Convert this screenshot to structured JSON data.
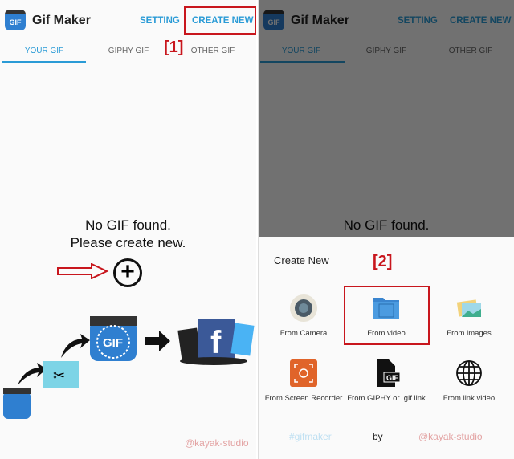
{
  "app": {
    "title": "Gif Maker",
    "logo_text": "GIF",
    "setting": "SETTING",
    "create_new": "CREATE NEW"
  },
  "tabs": [
    {
      "label": "YOUR GIF",
      "selected": true
    },
    {
      "label": "GIPHY GIF"
    },
    {
      "label": "OTHER GIF"
    }
  ],
  "annotations": {
    "step1": "[1]",
    "step2": "[2]",
    "color": "#c8161d"
  },
  "empty": {
    "line1": "No GIF found.",
    "line2": "Please create new."
  },
  "illustration": {
    "gif_text": "GIF",
    "facebook": "f"
  },
  "watermark": "@kayak-studio",
  "sheet": {
    "title": "Create New",
    "options": [
      {
        "label": "From Camera",
        "icon": "camera-icon"
      },
      {
        "label": "From video",
        "icon": "video-folder-icon"
      },
      {
        "label": "From images",
        "icon": "images-icon"
      },
      {
        "label": "From Screen Recorder",
        "icon": "screen-recorder-icon"
      },
      {
        "label": "From GIPHY or .gif link",
        "icon": "gif-file-icon",
        "icon_text": "GIF"
      },
      {
        "label": "From link video",
        "icon": "globe-icon"
      }
    ],
    "footer": {
      "hashtag": "#gifmaker",
      "by": "by",
      "author": "@kayak-studio"
    }
  },
  "colors": {
    "accent": "#2a9bd6",
    "watermark": "#e3a3a3",
    "hashtag": "#bfe0f2"
  }
}
